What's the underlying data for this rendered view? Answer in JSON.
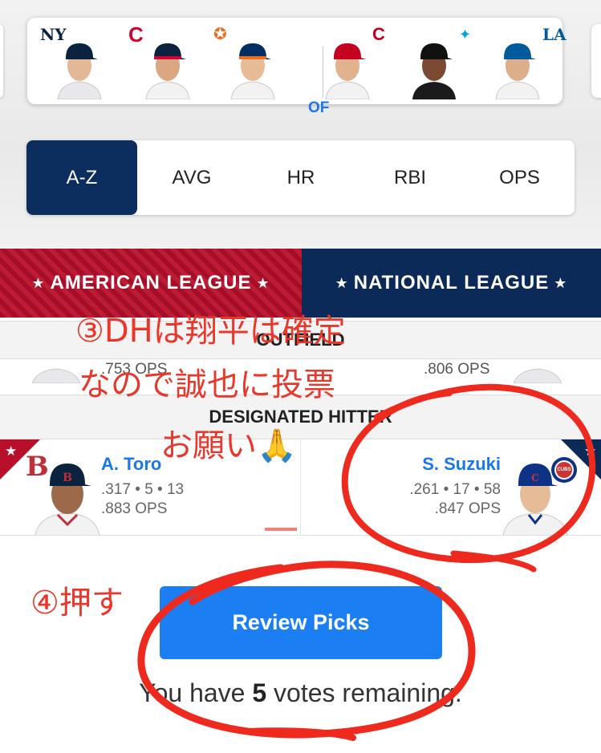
{
  "player_strip": {
    "position_label": "OF",
    "players": [
      {
        "team": "NYY",
        "logo_color": "#0c2340",
        "cap_color": "#0c2340",
        "jersey": "#e8e8ec"
      },
      {
        "team": "CLE",
        "logo_color": "#d50032",
        "cap_color": "#0c2340",
        "jersey": "#f2f2f2"
      },
      {
        "team": "HOU",
        "logo_color": "#eb6e1f",
        "cap_color": "#002d62",
        "jersey": "#f2f2f2"
      },
      {
        "team": "CIN",
        "logo_color": "#c6011f",
        "cap_color": "#c6011f",
        "jersey": "#f2f2f2"
      },
      {
        "team": "MIA",
        "logo_color": "#00a3e0",
        "cap_color": "#111111",
        "jersey": "#1b1b1b"
      },
      {
        "team": "LAD",
        "logo_color": "#005a9c",
        "cap_color": "#005a9c",
        "jersey": "#f2f2f2"
      }
    ]
  },
  "sort_tabs": [
    {
      "label": "A-Z",
      "active": true
    },
    {
      "label": "AVG",
      "active": false
    },
    {
      "label": "HR",
      "active": false
    },
    {
      "label": "RBI",
      "active": false
    },
    {
      "label": "OPS",
      "active": false
    }
  ],
  "leagues": {
    "al": "AMERICAN LEAGUE",
    "nl": "NATIONAL LEAGUE",
    "star": "★"
  },
  "sections": {
    "outfield": "OUTFIELD",
    "dh": "DESIGNATED HITTER"
  },
  "outfield_partial": {
    "al_ops": ".753 OPS",
    "nl_ops": ".806 OPS"
  },
  "dh": {
    "al": {
      "name": "A. Toro",
      "stats": ".317 • 5 • 13",
      "ops": ".883 OPS",
      "team_logo": "B",
      "team_color": "#bd3039"
    },
    "nl": {
      "name": "S. Suzuki",
      "stats": ".261 • 17 • 58",
      "ops": ".847 OPS",
      "team_logo": "CUBS",
      "team_color": "#0e3386"
    }
  },
  "review_button": "Review Picks",
  "votes": {
    "prefix": "You have",
    "count": "5",
    "suffix": "votes remaining."
  },
  "annotations": {
    "note3_line1": "③DHは翔平は確定",
    "note3_line2": "なので誠也に投票",
    "note3_line3": "お願い🙏",
    "note4": "④押す",
    "color": "#e8382c"
  },
  "colors": {
    "accent": "#1b77e8",
    "al_red": "#b8102a",
    "nl_navy": "#0b2a57",
    "tab_active": "#0c2e5f"
  }
}
